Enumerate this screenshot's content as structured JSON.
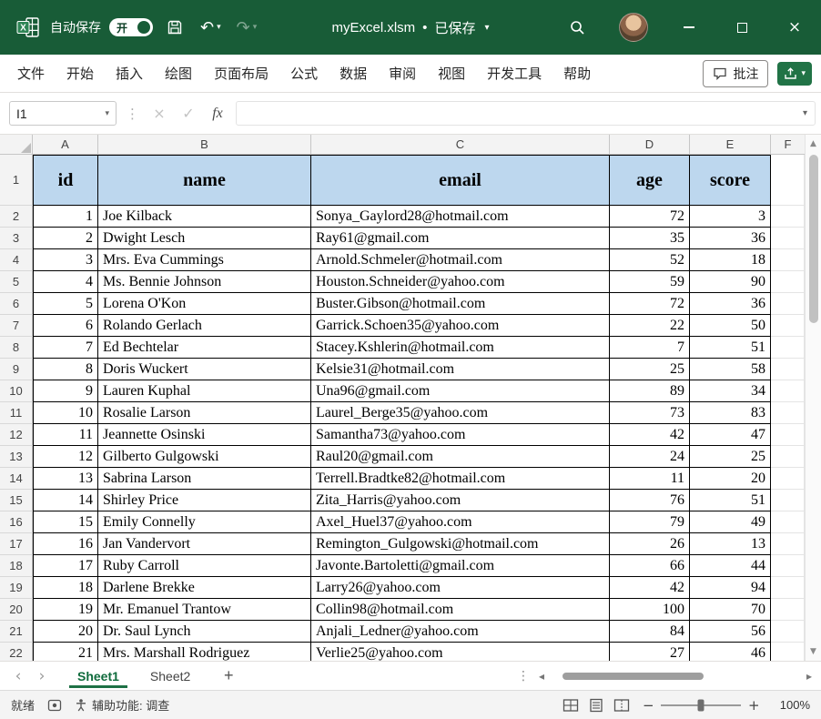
{
  "title_bar": {
    "autosave_label": "自动保存",
    "autosave_state": "开",
    "doc_title": "myExcel.xlsm",
    "separator": "•",
    "doc_status": "已保存"
  },
  "ribbon": {
    "tabs": [
      {
        "label": "文件"
      },
      {
        "label": "开始"
      },
      {
        "label": "插入"
      },
      {
        "label": "绘图"
      },
      {
        "label": "页面布局"
      },
      {
        "label": "公式"
      },
      {
        "label": "数据"
      },
      {
        "label": "审阅"
      },
      {
        "label": "视图"
      },
      {
        "label": "开发工具"
      },
      {
        "label": "帮助"
      }
    ],
    "comments_label": "批注"
  },
  "formula_bar": {
    "name_box_value": "I1",
    "fx_label": "fx",
    "formula_value": ""
  },
  "sheet": {
    "column_letters": [
      "A",
      "B",
      "C",
      "D",
      "E",
      "F"
    ],
    "table_header": [
      "id",
      "name",
      "email",
      "age",
      "score"
    ],
    "rows": [
      [
        "1",
        "Joe Kilback",
        "Sonya_Gaylord28@hotmail.com",
        "72",
        "3"
      ],
      [
        "2",
        "Dwight Lesch",
        "Ray61@gmail.com",
        "35",
        "36"
      ],
      [
        "3",
        "Mrs. Eva Cummings",
        "Arnold.Schmeler@hotmail.com",
        "52",
        "18"
      ],
      [
        "4",
        "Ms. Bennie Johnson",
        "Houston.Schneider@yahoo.com",
        "59",
        "90"
      ],
      [
        "5",
        "Lorena O'Kon",
        "Buster.Gibson@hotmail.com",
        "72",
        "36"
      ],
      [
        "6",
        "Rolando Gerlach",
        "Garrick.Schoen35@yahoo.com",
        "22",
        "50"
      ],
      [
        "7",
        "Ed Bechtelar",
        "Stacey.Kshlerin@hotmail.com",
        "7",
        "51"
      ],
      [
        "8",
        "Doris Wuckert",
        "Kelsie31@hotmail.com",
        "25",
        "58"
      ],
      [
        "9",
        "Lauren Kuphal",
        "Una96@gmail.com",
        "89",
        "34"
      ],
      [
        "10",
        "Rosalie Larson",
        "Laurel_Berge35@yahoo.com",
        "73",
        "83"
      ],
      [
        "11",
        "Jeannette Osinski",
        "Samantha73@yahoo.com",
        "42",
        "47"
      ],
      [
        "12",
        "Gilberto Gulgowski",
        "Raul20@gmail.com",
        "24",
        "25"
      ],
      [
        "13",
        "Sabrina Larson",
        "Terrell.Bradtke82@hotmail.com",
        "11",
        "20"
      ],
      [
        "14",
        "Shirley Price",
        "Zita_Harris@yahoo.com",
        "76",
        "51"
      ],
      [
        "15",
        "Emily Connelly",
        "Axel_Huel37@yahoo.com",
        "79",
        "49"
      ],
      [
        "16",
        "Jan Vandervort",
        "Remington_Gulgowski@hotmail.com",
        "26",
        "13"
      ],
      [
        "17",
        "Ruby Carroll",
        "Javonte.Bartoletti@gmail.com",
        "66",
        "44"
      ],
      [
        "18",
        "Darlene Brekke",
        "Larry26@yahoo.com",
        "42",
        "94"
      ],
      [
        "19",
        "Mr. Emanuel Trantow",
        "Collin98@hotmail.com",
        "100",
        "70"
      ],
      [
        "20",
        "Dr. Saul Lynch",
        "Anjali_Ledner@yahoo.com",
        "84",
        "56"
      ],
      [
        "21",
        "Mrs. Marshall Rodriguez",
        "Verlie25@yahoo.com",
        "27",
        "46"
      ]
    ]
  },
  "sheet_bar": {
    "tabs": [
      {
        "label": "Sheet1",
        "active": true
      },
      {
        "label": "Sheet2",
        "active": false
      }
    ],
    "add_label": "+"
  },
  "status_bar": {
    "ready_label": "就绪",
    "accessibility_label": "辅助功能: 调查",
    "zoom_level": "100%"
  },
  "icons": {
    "undo": "↶",
    "redo": "↷",
    "chevron_down": "▾",
    "vertical_dots": "⋮",
    "cancel": "×",
    "enter": "✓",
    "close": "×",
    "nav_left": "‹",
    "nav_right": "›",
    "scroll_up": "▲",
    "scroll_down": "▼",
    "scroll_left": "◂",
    "scroll_right": "▸",
    "zoom_out": "−",
    "zoom_in": "+"
  },
  "colors": {
    "titlebar_bg": "#185C37",
    "table_header_fill": "#BDD7EE",
    "sheet_accent": "#1E7145"
  }
}
